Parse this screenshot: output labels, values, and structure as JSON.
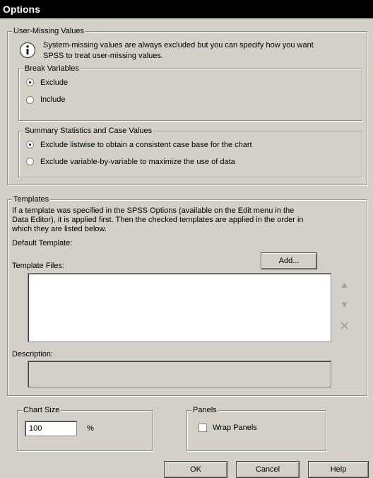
{
  "window": {
    "title": "Options"
  },
  "user_missing": {
    "legend": "User-Missing Values",
    "info_line1": "System-missing values are always excluded but you can specify how you want",
    "info_line2": "SPSS to treat user-missing values.",
    "break_variables": {
      "legend": "Break Variables",
      "exclude_label": "Exclude",
      "include_label": "Include",
      "selected": "Exclude"
    },
    "summary": {
      "legend": "Summary Statistics and Case Values",
      "listwise_label": "Exclude listwise to obtain a consistent case base for the chart",
      "variable_label": "Exclude variable-by-variable to maximize the use of data",
      "selected": "listwise"
    }
  },
  "templates": {
    "legend": "Templates",
    "info_line1": "If a template was specified in the SPSS Options (available on the Edit menu in the",
    "info_line2": "Data Editor), it is applied first. Then the checked templates are applied in the order in",
    "info_line3": "which they are listed below.",
    "default_label": "Default Template:",
    "files_label": "Template Files:",
    "add_button": "Add...",
    "description_label": "Description:"
  },
  "chart_size": {
    "legend": "Chart Size",
    "value": "100",
    "unit": "%"
  },
  "panels": {
    "legend": "Panels",
    "wrap_label": "Wrap Panels",
    "wrap_checked": false
  },
  "buttons": {
    "ok": "OK",
    "cancel": "Cancel",
    "help": "Help"
  }
}
